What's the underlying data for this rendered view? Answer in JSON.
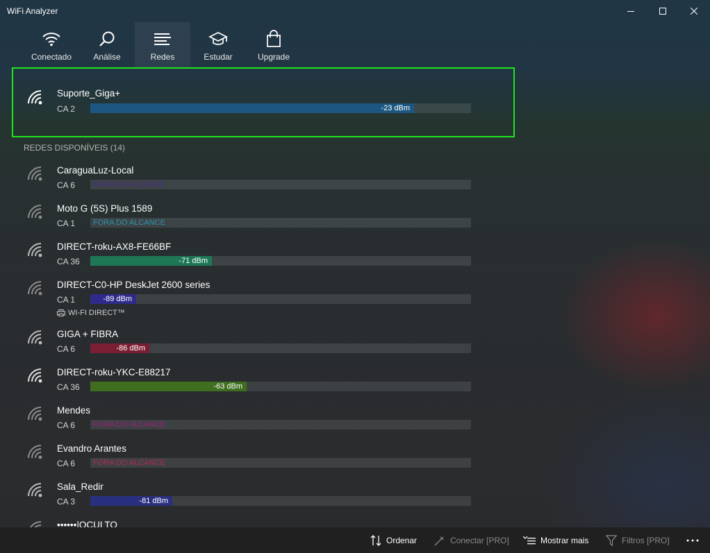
{
  "app": {
    "title": "WiFi Analyzer"
  },
  "window_controls": [
    "minimize-icon",
    "maximize-icon",
    "close-icon"
  ],
  "tabs": [
    {
      "label": "Conectado",
      "icon": "wifi-icon",
      "active": false
    },
    {
      "label": "Análise",
      "icon": "magnifier-icon",
      "active": false
    },
    {
      "label": "Redes",
      "icon": "list-icon",
      "active": true
    },
    {
      "label": "Estudar",
      "icon": "graduation-cap-icon",
      "active": false
    },
    {
      "label": "Upgrade",
      "icon": "shopping-bag-icon",
      "active": false
    }
  ],
  "connected": {
    "name": "Suporte_Giga+",
    "channel": "CA 2",
    "signal": "-23 dBm",
    "signal_fraction": 0.85,
    "color": "#1c5781",
    "highlight_color": "#1ee51e"
  },
  "available_header": "REDES DISPONÍVEIS (14)",
  "networks": [
    {
      "name": "CaraguaLuz-Local",
      "channel": "CA 6",
      "signal": "",
      "out_of_range": "FORA DO ALCANCE",
      "signal_fraction": 0,
      "color": "#4b2a8c",
      "strength": "weak"
    },
    {
      "name": "Moto G (5S) Plus 1589",
      "channel": "CA 1",
      "signal": "",
      "out_of_range": "FORA DO ALCANCE",
      "signal_fraction": 0,
      "color": "#2f93b0",
      "strength": "weak"
    },
    {
      "name": "DIRECT-roku-AX8-FE66BF",
      "channel": "CA 36",
      "signal": "-71 dBm",
      "out_of_range": "",
      "signal_fraction": 0.32,
      "color": "#1e7856",
      "strength": "medium"
    },
    {
      "name": "DIRECT-C0-HP DeskJet 2600 series",
      "channel": "CA 1",
      "signal": "-89 dBm",
      "out_of_range": "",
      "signal_fraction": 0.12,
      "color": "#2e2b8c",
      "strength": "weak",
      "tag": "WI-FI DIRECT™"
    },
    {
      "name": "GIGA + FIBRA",
      "channel": "CA 6",
      "signal": "-86 dBm",
      "out_of_range": "",
      "signal_fraction": 0.155,
      "color": "#7a1f33",
      "strength": "medium"
    },
    {
      "name": "DIRECT-roku-YKC-E88217",
      "channel": "CA 36",
      "signal": "-63 dBm",
      "out_of_range": "",
      "signal_fraction": 0.41,
      "color": "#3f6e1f",
      "strength": "strong"
    },
    {
      "name": "Mendes",
      "channel": "CA 6",
      "signal": "",
      "out_of_range": "FORA DO ALCANCE",
      "signal_fraction": 0,
      "color": "#9c1f7c",
      "strength": "weak"
    },
    {
      "name": "Evandro Arantes",
      "channel": "CA 6",
      "signal": "",
      "out_of_range": "FORA DO ALCANCE",
      "signal_fraction": 0,
      "color": "#b02a5a",
      "strength": "weak"
    },
    {
      "name": "Sala_Redir",
      "channel": "CA 3",
      "signal": "-81 dBm",
      "out_of_range": "",
      "signal_fraction": 0.215,
      "color": "#2a3080",
      "strength": "medium"
    },
    {
      "name": "••••••|OCULTO",
      "channel": "",
      "signal": "",
      "out_of_range": "",
      "signal_fraction": 0,
      "color": "#444444",
      "strength": "weak"
    }
  ],
  "commands": [
    {
      "label": "Ordenar",
      "icon": "sort-icon",
      "enabled": true
    },
    {
      "label": "Conectar [PRO]",
      "icon": "disconnect-icon",
      "enabled": false
    },
    {
      "label": "Mostrar mais",
      "icon": "list-more-icon",
      "enabled": true
    },
    {
      "label": "Filtros [PRO]",
      "icon": "filter-icon",
      "enabled": false
    }
  ],
  "more_icon": "ellipsis-icon"
}
